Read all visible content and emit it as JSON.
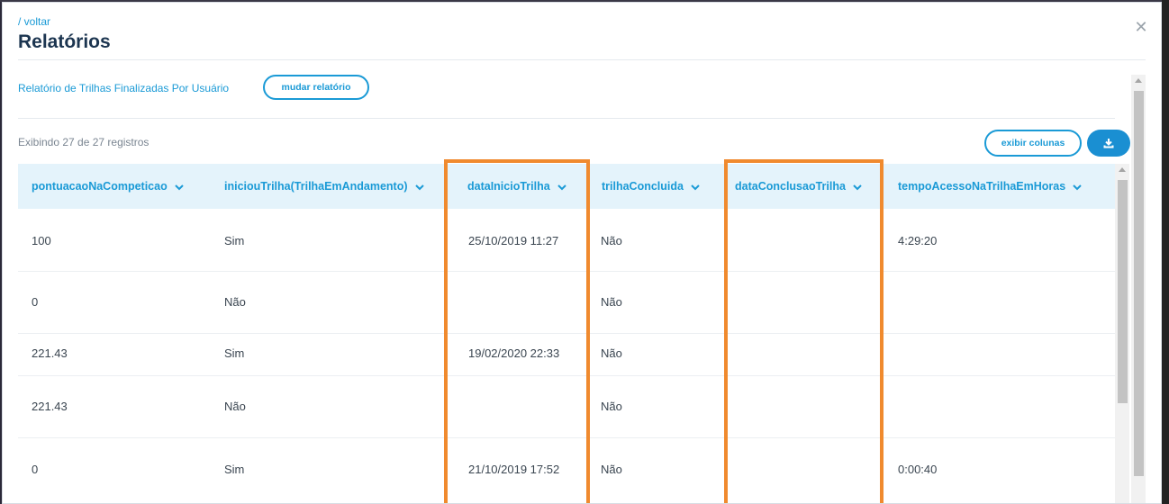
{
  "header": {
    "back_label": "/ voltar",
    "title": "Relatórios",
    "close_icon": "close-icon"
  },
  "report": {
    "name": "Relatório de Trilhas Finalizadas Por Usuário",
    "change_button": "mudar relatório"
  },
  "toolbar": {
    "records_text": "Exibindo 27 de 27 registros",
    "columns_button": "exibir colunas",
    "download_icon": "download-icon"
  },
  "table": {
    "columns": [
      "pontuacaoNaCompeticao",
      "iniciouTrilha(TrilhaEmAndamento)",
      "dataInicioTrilha",
      "trilhaConcluida",
      "dataConclusaoTrilha",
      "tempoAcessoNaTrilhaEmHoras"
    ],
    "rows": [
      [
        "100",
        "Sim",
        "25/10/2019 11:27",
        "Não",
        "",
        "4:29:20"
      ],
      [
        "0",
        "Não",
        "",
        "Não",
        "",
        ""
      ],
      [
        "221.43",
        "Sim",
        "19/02/2020 22:33",
        "Não",
        "",
        ""
      ],
      [
        "221.43",
        "Não",
        "",
        "Não",
        "",
        ""
      ],
      [
        "0",
        "Sim",
        "21/10/2019 17:52",
        "Não",
        "",
        "0:00:40"
      ]
    ]
  },
  "colors": {
    "accent": "#1a9ad6",
    "title": "#1c3550",
    "header_bg": "#e4f3fb",
    "highlight": "#f08a2e"
  }
}
